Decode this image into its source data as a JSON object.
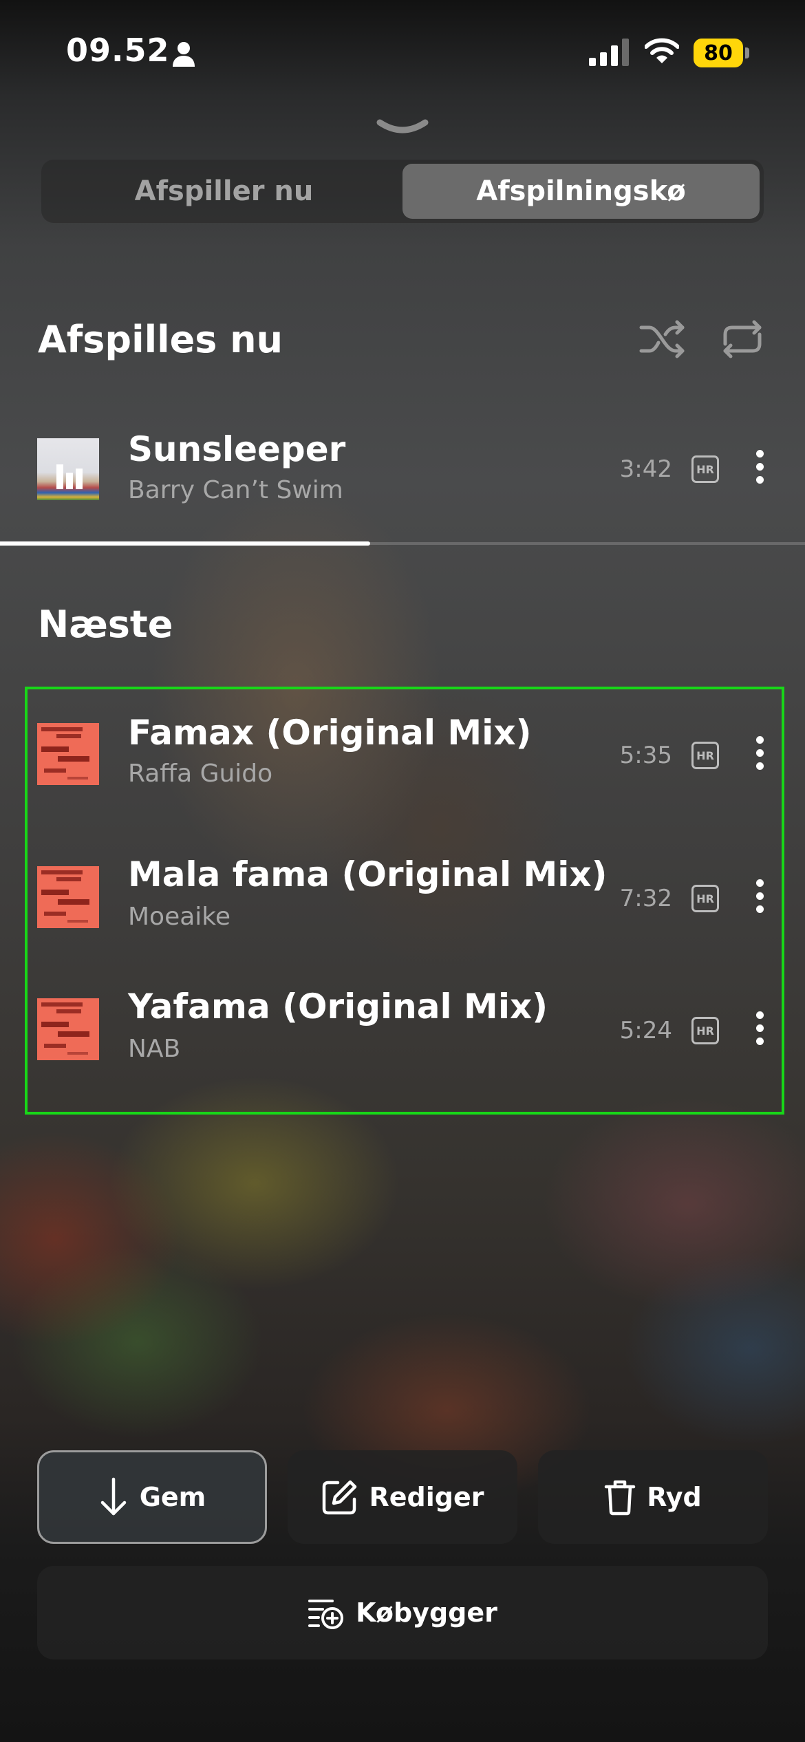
{
  "status_bar": {
    "time": "09.52",
    "battery": "80",
    "icons": [
      "person-icon",
      "signal-icon",
      "wifi-icon",
      "battery-icon"
    ],
    "battery_color": "#ffd60a"
  },
  "segment": {
    "tabs": [
      {
        "label": "Afspiller nu",
        "active": false
      },
      {
        "label": "Afspilningskø",
        "active": true
      }
    ]
  },
  "now_playing": {
    "section_title": "Afspilles nu",
    "track": {
      "title": "Sunsleeper",
      "artist": "Barry Can’t Swim",
      "duration": "3:42",
      "quality": "HR",
      "progress": 0.46
    }
  },
  "next": {
    "section_title": "Næste",
    "tracks": [
      {
        "title": "Famax (Original Mix)",
        "artist": "Raffa Guido",
        "duration": "5:35",
        "quality": "HR"
      },
      {
        "title": "Mala fama (Original Mix)",
        "artist": "Moeaike",
        "duration": "7:32",
        "quality": "HR"
      },
      {
        "title": "Yafama (Original Mix)",
        "artist": "NAB",
        "duration": "5:24",
        "quality": "HR"
      }
    ]
  },
  "actions": {
    "save_label": "Gem",
    "edit_label": "Rediger",
    "clear_label": "Ryd",
    "queue_builder_label": "Købygger"
  },
  "highlight_color": "#18d718"
}
